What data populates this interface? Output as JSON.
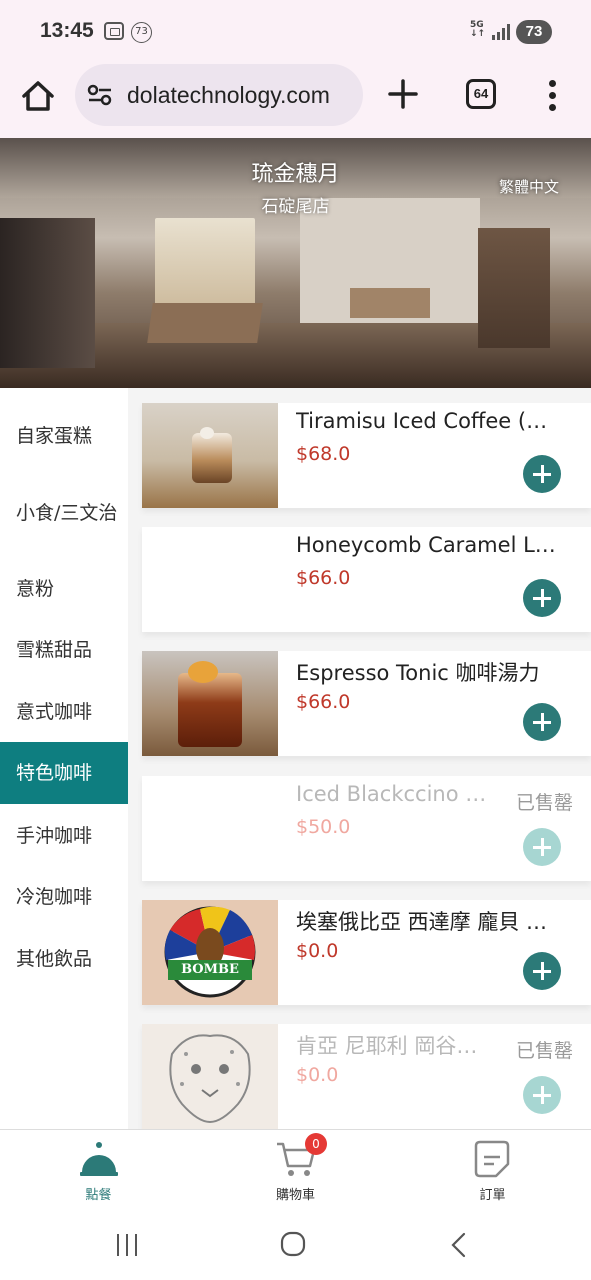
{
  "status_bar": {
    "time": "13:45",
    "notification_count": "73",
    "network": "5G",
    "battery": "73"
  },
  "browser": {
    "url": "dolatechnology.com",
    "tab_count": "64"
  },
  "hero": {
    "shop_name": "琉金穗月",
    "branch": "石碇尾店",
    "language": "繁體中文"
  },
  "categories": [
    "自家蛋糕",
    "小食/三文治",
    "意粉",
    "雪糕甜品",
    "意式咖啡",
    "特色咖啡",
    "手沖咖啡",
    "冷泡咖啡",
    "其他飲品"
  ],
  "active_category": "特色咖啡",
  "items": [
    {
      "name": "Tiramisu Iced Coffee (…",
      "price": "$68.0",
      "sold_out": ""
    },
    {
      "name": "Honeycomb Caramel L…",
      "price": "$66.0",
      "sold_out": ""
    },
    {
      "name": "Espresso Tonic 咖啡湯力",
      "price": "$66.0",
      "sold_out": ""
    },
    {
      "name": "Iced Blackccino …",
      "price": "$50.0",
      "sold_out": "已售罄"
    },
    {
      "name": "埃塞俄比亞 西達摩 龐貝 …",
      "price": "$0.0",
      "sold_out": "",
      "thumb_text": "BOMBE"
    },
    {
      "name": "肯亞 尼耶利 岡谷…",
      "price": "$0.0",
      "sold_out": "已售罄"
    }
  ],
  "bottom_nav": {
    "order": "點餐",
    "cart": "購物車",
    "cart_count": "0",
    "orders": "訂單"
  },
  "colors": {
    "accent": "#0e7e80",
    "add_button": "#2c7a78",
    "price": "#c0392b"
  }
}
